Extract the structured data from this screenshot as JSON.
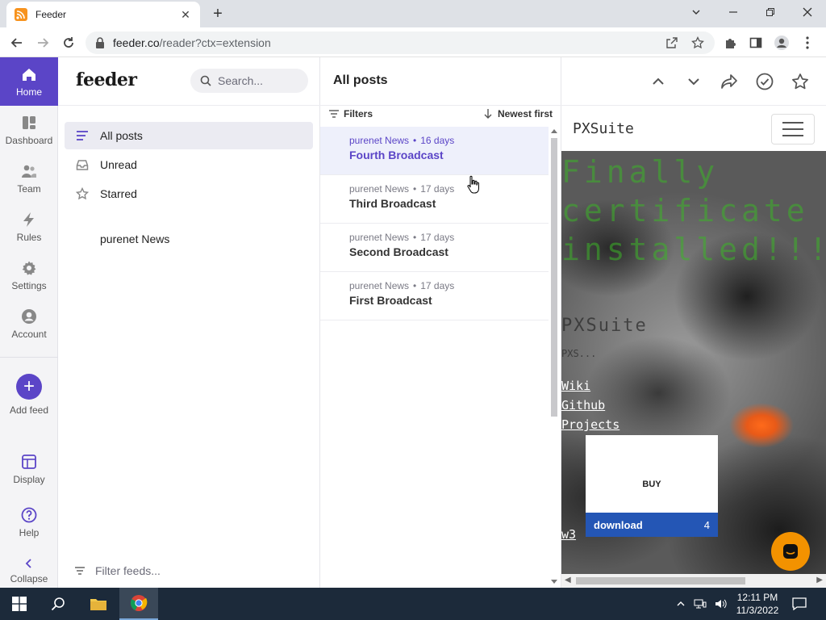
{
  "browser": {
    "tab_title": "Feeder",
    "tab_close": "✕",
    "new_tab": "+",
    "url_host": "feeder.co",
    "url_path": "/reader?ctx=extension"
  },
  "nav": {
    "items": [
      {
        "label": "Home",
        "icon": "home-icon"
      },
      {
        "label": "Dashboard",
        "icon": "dashboard-icon"
      },
      {
        "label": "Team",
        "icon": "team-icon"
      },
      {
        "label": "Rules",
        "icon": "bolt-icon"
      },
      {
        "label": "Settings",
        "icon": "gear-icon"
      },
      {
        "label": "Account",
        "icon": "account-icon"
      }
    ],
    "add_feed": "Add feed",
    "display": "Display",
    "help": "Help",
    "collapse": "Collapse",
    "accent": "#5b45c7"
  },
  "feeds": {
    "logo": "feeder",
    "search_placeholder": "Search...",
    "items": [
      {
        "label": "All posts",
        "icon": "list-icon"
      },
      {
        "label": "Unread",
        "icon": "inbox-icon"
      },
      {
        "label": "Starred",
        "icon": "star-icon"
      }
    ],
    "feed_name": "purenet News",
    "filter_feeds": "Filter feeds..."
  },
  "posts": {
    "title": "All posts",
    "filters": "Filters",
    "sort": "Newest first",
    "items": [
      {
        "source": "purenet News",
        "age": "16 days",
        "title": "Fourth Broadcast"
      },
      {
        "source": "purenet News",
        "age": "17 days",
        "title": "Third Broadcast"
      },
      {
        "source": "purenet News",
        "age": "17 days",
        "title": "Second Broadcast"
      },
      {
        "source": "purenet News",
        "age": "17 days",
        "title": "First Broadcast"
      }
    ]
  },
  "reader": {
    "site_name": "PXSuite",
    "hero_title": "Finally certificate is installed!!!!!",
    "hero_sub": "PXSuite",
    "hero_small": "PXS...",
    "links": [
      "Wiki",
      "Github",
      "Projects",
      "w3"
    ],
    "buy_label": "BUY",
    "download_label": "download",
    "download_count": "4"
  },
  "taskbar": {
    "time": "12:11 PM",
    "date": "11/3/2022"
  }
}
